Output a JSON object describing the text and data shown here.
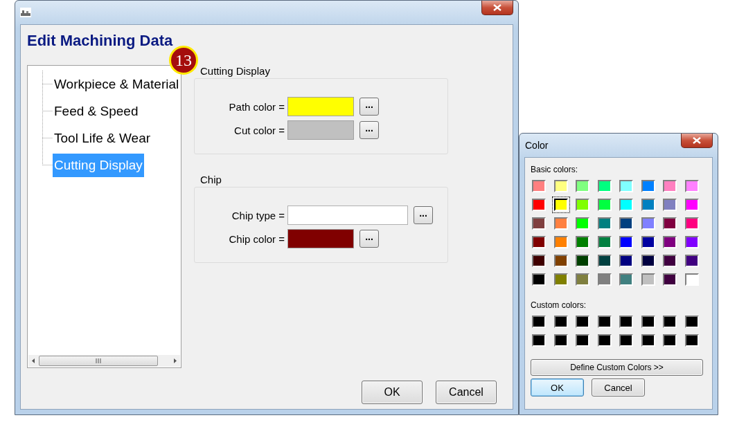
{
  "main_window": {
    "heading": "Edit Machining Data",
    "tree": [
      {
        "label": "Workpiece & Material",
        "selected": false
      },
      {
        "label": "Feed & Speed",
        "selected": false
      },
      {
        "label": "Tool Life & Wear",
        "selected": false
      },
      {
        "label": "Cutting Display",
        "selected": true
      }
    ],
    "groups": [
      {
        "title": "Cutting Display",
        "rows": [
          {
            "label": "Path color =",
            "kind": "color",
            "color": "#ffff00",
            "button_label": "..."
          },
          {
            "label": "Cut color =",
            "kind": "color",
            "color": "#c0c0c0",
            "button_label": "..."
          }
        ]
      },
      {
        "title": "Chip",
        "rows": [
          {
            "label": "Chip type =",
            "kind": "text",
            "button_label": "..."
          },
          {
            "label": "Chip color =",
            "kind": "color",
            "color": "#800000",
            "button_label": "..."
          }
        ]
      }
    ],
    "buttons": [
      {
        "label": "OK",
        "default": false
      },
      {
        "label": "Cancel",
        "default": false
      }
    ]
  },
  "callout": "13",
  "color_dialog": {
    "title": "Color",
    "basic_label": "Basic colors:",
    "basic_colors": [
      {
        "color": "#ff8080",
        "selected": false
      },
      {
        "color": "#ffff80",
        "selected": false
      },
      {
        "color": "#80ff80",
        "selected": false
      },
      {
        "color": "#00ff80",
        "selected": false
      },
      {
        "color": "#80ffff",
        "selected": false
      },
      {
        "color": "#0080ff",
        "selected": false
      },
      {
        "color": "#ff80c0",
        "selected": false
      },
      {
        "color": "#ff80ff",
        "selected": false
      },
      {
        "color": "#ff0000",
        "selected": false
      },
      {
        "color": "#ffff00",
        "selected": true
      },
      {
        "color": "#80ff00",
        "selected": false
      },
      {
        "color": "#00ff40",
        "selected": false
      },
      {
        "color": "#00ffff",
        "selected": false
      },
      {
        "color": "#0080c0",
        "selected": false
      },
      {
        "color": "#8080c0",
        "selected": false
      },
      {
        "color": "#ff00ff",
        "selected": false
      },
      {
        "color": "#804040",
        "selected": false
      },
      {
        "color": "#ff8040",
        "selected": false
      },
      {
        "color": "#00ff00",
        "selected": false
      },
      {
        "color": "#008080",
        "selected": false
      },
      {
        "color": "#004080",
        "selected": false
      },
      {
        "color": "#8080ff",
        "selected": false
      },
      {
        "color": "#800040",
        "selected": false
      },
      {
        "color": "#ff0080",
        "selected": false
      },
      {
        "color": "#800000",
        "selected": false
      },
      {
        "color": "#ff8000",
        "selected": false
      },
      {
        "color": "#008000",
        "selected": false
      },
      {
        "color": "#008040",
        "selected": false
      },
      {
        "color": "#0000ff",
        "selected": false
      },
      {
        "color": "#0000a0",
        "selected": false
      },
      {
        "color": "#800080",
        "selected": false
      },
      {
        "color": "#8000ff",
        "selected": false
      },
      {
        "color": "#400000",
        "selected": false
      },
      {
        "color": "#804000",
        "selected": false
      },
      {
        "color": "#004000",
        "selected": false
      },
      {
        "color": "#004040",
        "selected": false
      },
      {
        "color": "#000080",
        "selected": false
      },
      {
        "color": "#000040",
        "selected": false
      },
      {
        "color": "#400040",
        "selected": false
      },
      {
        "color": "#400080",
        "selected": false
      },
      {
        "color": "#000000",
        "selected": false
      },
      {
        "color": "#808000",
        "selected": false
      },
      {
        "color": "#808040",
        "selected": false
      },
      {
        "color": "#808080",
        "selected": false
      },
      {
        "color": "#408080",
        "selected": false
      },
      {
        "color": "#c0c0c0",
        "selected": false
      },
      {
        "color": "#400040",
        "selected": false
      },
      {
        "color": "#ffffff",
        "selected": false
      }
    ],
    "custom_label": "Custom colors:",
    "custom_colors": [
      {
        "color": "#000000"
      },
      {
        "color": "#000000"
      },
      {
        "color": "#000000"
      },
      {
        "color": "#000000"
      },
      {
        "color": "#000000"
      },
      {
        "color": "#000000"
      },
      {
        "color": "#000000"
      },
      {
        "color": "#000000"
      },
      {
        "color": "#000000"
      },
      {
        "color": "#000000"
      },
      {
        "color": "#000000"
      },
      {
        "color": "#000000"
      },
      {
        "color": "#000000"
      },
      {
        "color": "#000000"
      },
      {
        "color": "#000000"
      },
      {
        "color": "#000000"
      }
    ],
    "define_button": "Define Custom Colors >>",
    "buttons": [
      {
        "label": "OK",
        "default": true
      },
      {
        "label": "Cancel",
        "default": false
      }
    ]
  }
}
